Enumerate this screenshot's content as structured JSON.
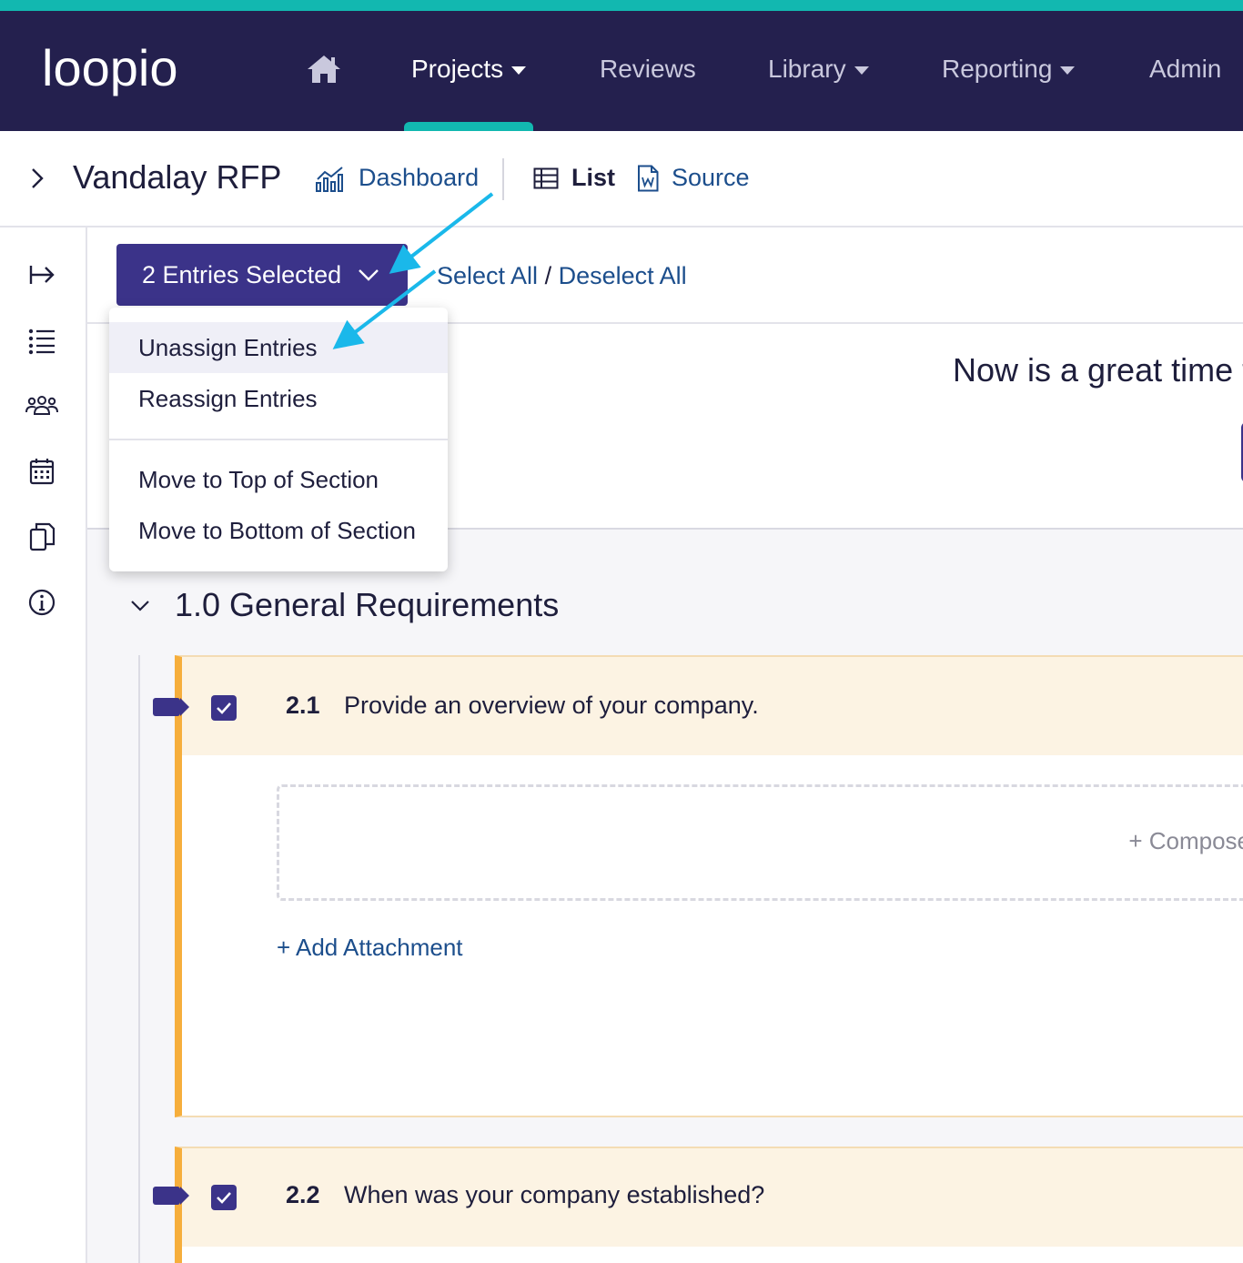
{
  "nav": {
    "logo_text": "loopio",
    "items": [
      {
        "label": "Projects"
      },
      {
        "label": "Reviews"
      },
      {
        "label": "Library"
      },
      {
        "label": "Reporting"
      },
      {
        "label": "Admin"
      }
    ]
  },
  "header": {
    "project_title": "Vandalay RFP",
    "views": [
      {
        "label": "Dashboard"
      },
      {
        "label": "List"
      },
      {
        "label": "Source"
      }
    ]
  },
  "toolbar": {
    "entries_selected_label": "2 Entries Selected",
    "select_all": "Select All",
    "separator": "/",
    "deselect_all": "Deselect All"
  },
  "dropdown": {
    "items": [
      {
        "label": "Unassign Entries"
      },
      {
        "label": "Reassign Entries"
      },
      {
        "label": "Move to Top of Section"
      },
      {
        "label": "Move to Bottom of Section"
      }
    ]
  },
  "banner": {
    "text": "Now is a great time t"
  },
  "section": {
    "title": "1.0 General Requirements"
  },
  "entries": [
    {
      "number": "2.1",
      "question": "Provide an overview of your company.",
      "compose_label": "+ Compose",
      "attachment_label": "+ Add Attachment"
    },
    {
      "number": "2.2",
      "question": "When was your company established?"
    }
  ],
  "colors": {
    "nav_bg": "#24204e",
    "accent_teal": "#12b8b0",
    "primary_purple": "#3b3389",
    "link_blue": "#1c4e8c",
    "entry_border_orange": "#f6ae3c",
    "entry_header_bg": "#fcf3e3",
    "annotation_arrow": "#1ab8ea"
  }
}
